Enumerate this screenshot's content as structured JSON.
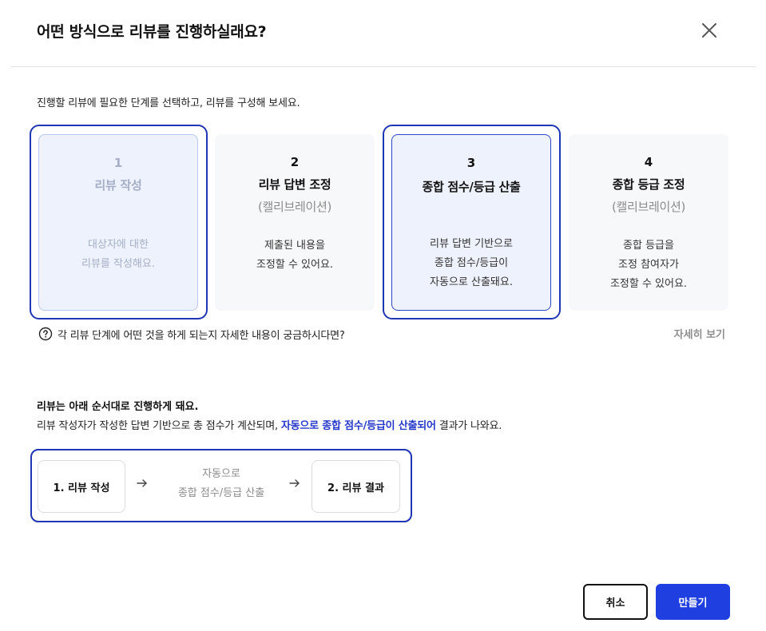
{
  "dialog": {
    "title": "어떤 방식으로 리뷰를 진행하실래요?",
    "close_icon": "close-icon"
  },
  "intro": "진행할 리뷰에 필요한 단계를 선택하고, 리뷰를 구성해 보세요.",
  "steps": [
    {
      "num": "1",
      "name": "리뷰 작성",
      "sub": "",
      "desc1": "대상자에 대한",
      "desc2": "리뷰를 작성해요.",
      "desc3": "",
      "state": "disabled-selected"
    },
    {
      "num": "2",
      "name": "리뷰 답변 조정",
      "sub": "(캘리브레이션)",
      "desc1": "제출된 내용을",
      "desc2": "조정할 수 있어요.",
      "desc3": "",
      "state": "unselected"
    },
    {
      "num": "3",
      "name": "종합 점수/등급 산출",
      "sub": "",
      "desc1": "리뷰 답변 기반으로",
      "desc2": "종합 점수/등급이",
      "desc3": "자동으로 산출돼요.",
      "state": "selected"
    },
    {
      "num": "4",
      "name": "종합 등급 조정",
      "sub": "(캘리브레이션)",
      "desc1": "종합 등급을",
      "desc2": "조정 참여자가",
      "desc3": "조정할 수 있어요.",
      "state": "unselected"
    }
  ],
  "help": {
    "icon": "question-circle-icon",
    "text": "각 리뷰 단계에 어떤 것을 하게 되는지 자세한 내용이 궁금하시다면?",
    "link": "자세히 보기"
  },
  "flow": {
    "title": "리뷰는 아래 순서대로 진행하게 돼요.",
    "desc_before": "리뷰 작성자가 작성한 답변 기반으로 총 점수가 계산되며, ",
    "desc_highlight": "자동으로 종합 점수/등급이 산출되어",
    "desc_after": " 결과가 나와요.",
    "card1": "1. 리뷰 작성",
    "mid_line1": "자동으로",
    "mid_line2": "종합 점수/등급 산출",
    "card2": "2. 리뷰 결과",
    "arrow_icon": "arrow-right-icon"
  },
  "buttons": {
    "cancel": "취소",
    "create": "만들기"
  },
  "colors": {
    "accent": "#1f3fe0",
    "outline": "#1f36b5",
    "highlight_text": "#2437c9"
  }
}
